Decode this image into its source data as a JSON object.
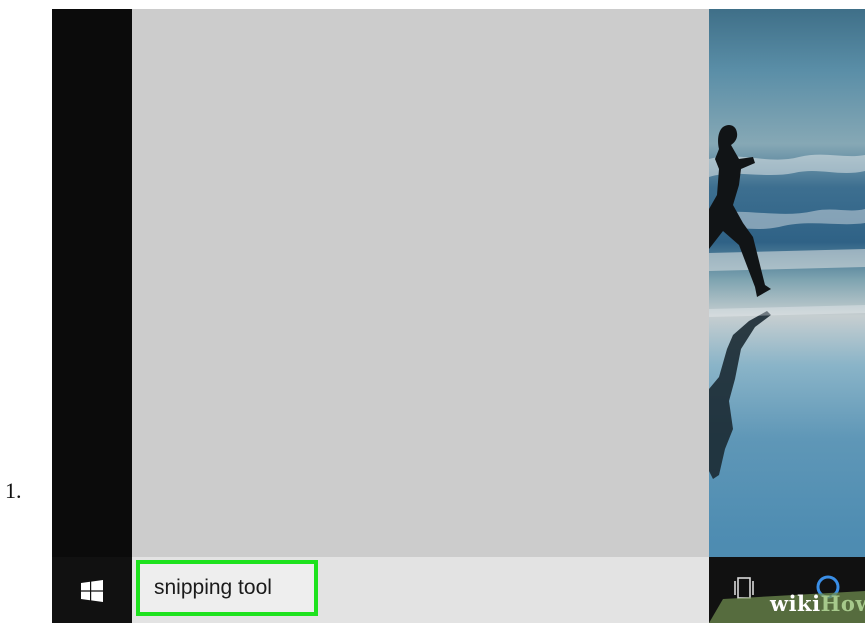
{
  "step": {
    "number": "1."
  },
  "taskbar": {
    "search_value": "snipping tool",
    "icons": [
      "windows-logo-icon",
      "task-view-icon",
      "cortana-icon"
    ],
    "highlight_color": "#1ee21e"
  },
  "start_menu": {
    "panel_color": "#cccccc",
    "sidebar_color": "#0b0b0b"
  },
  "watermark": {
    "part1": "wiki",
    "part2": "How",
    "part1_color": "#ffffff",
    "part2_color": "#a6c98b"
  }
}
